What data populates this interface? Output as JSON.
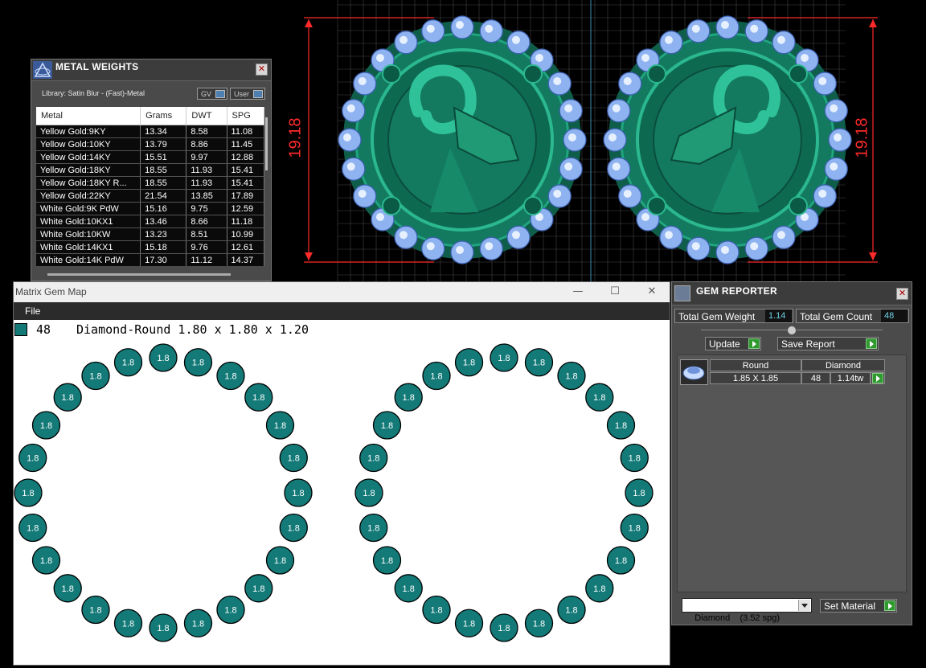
{
  "viewport": {
    "dimension_left": "19.18",
    "dimension_right": "19.18",
    "colors": {
      "metal": "#137a5f",
      "gem": "#8fb2f0",
      "dimension": "#ff2a2a",
      "grid": "#444444"
    }
  },
  "metal_weights": {
    "title": "METAL WEIGHTS",
    "library": "Library: Satin Blur - (Fast)-Metal",
    "gv_label": "GV",
    "user_label": "User",
    "columns": [
      "Metal",
      "Grams",
      "DWT",
      "SPG"
    ],
    "rows": [
      [
        "Yellow Gold:9KY",
        "13.34",
        "8.58",
        "11.08"
      ],
      [
        "Yellow Gold:10KY",
        "13.79",
        "8.86",
        "11.45"
      ],
      [
        "Yellow Gold:14KY",
        "15.51",
        "9.97",
        "12.88"
      ],
      [
        "Yellow Gold:18KY",
        "18.55",
        "11.93",
        "15.41"
      ],
      [
        "Yellow Gold:18KY R...",
        "18.55",
        "11.93",
        "15.41"
      ],
      [
        "Yellow Gold:22KY",
        "21.54",
        "13.85",
        "17.89"
      ],
      [
        "White Gold:9K PdW",
        "15.16",
        "9.75",
        "12.59"
      ],
      [
        "White Gold:10KX1",
        "13.46",
        "8.66",
        "11.18"
      ],
      [
        "White Gold:10KW",
        "13.23",
        "8.51",
        "10.99"
      ],
      [
        "White Gold:14KX1",
        "15.18",
        "9.76",
        "12.61"
      ],
      [
        "White Gold:14K PdW",
        "17.30",
        "11.12",
        "14.37"
      ]
    ]
  },
  "gem_map": {
    "window_title": "Matrix Gem Map",
    "menu_file": "File",
    "legend_count": "48",
    "legend_desc": "Diamond-Round 1.80 x 1.80 x 1.20",
    "gem_label": "1.8",
    "gem_color": "#137a78",
    "controls": {
      "minimize": "—",
      "maximize": "☐",
      "close": "✕"
    }
  },
  "gem_reporter": {
    "title": "GEM REPORTER",
    "total_weight_label": "Total Gem Weight",
    "total_weight_value": "1.14",
    "total_count_label": "Total Gem Count",
    "total_count_value": "48",
    "update_label": "Update",
    "save_report_label": "Save Report",
    "list_headers": [
      "Round",
      "Diamond"
    ],
    "gem_row": {
      "size": "1.85 X 1.85",
      "count": "48",
      "weight": "1.14tw"
    },
    "material": "Diamond    (3.52 spg)",
    "set_material_label": "Set Material"
  }
}
